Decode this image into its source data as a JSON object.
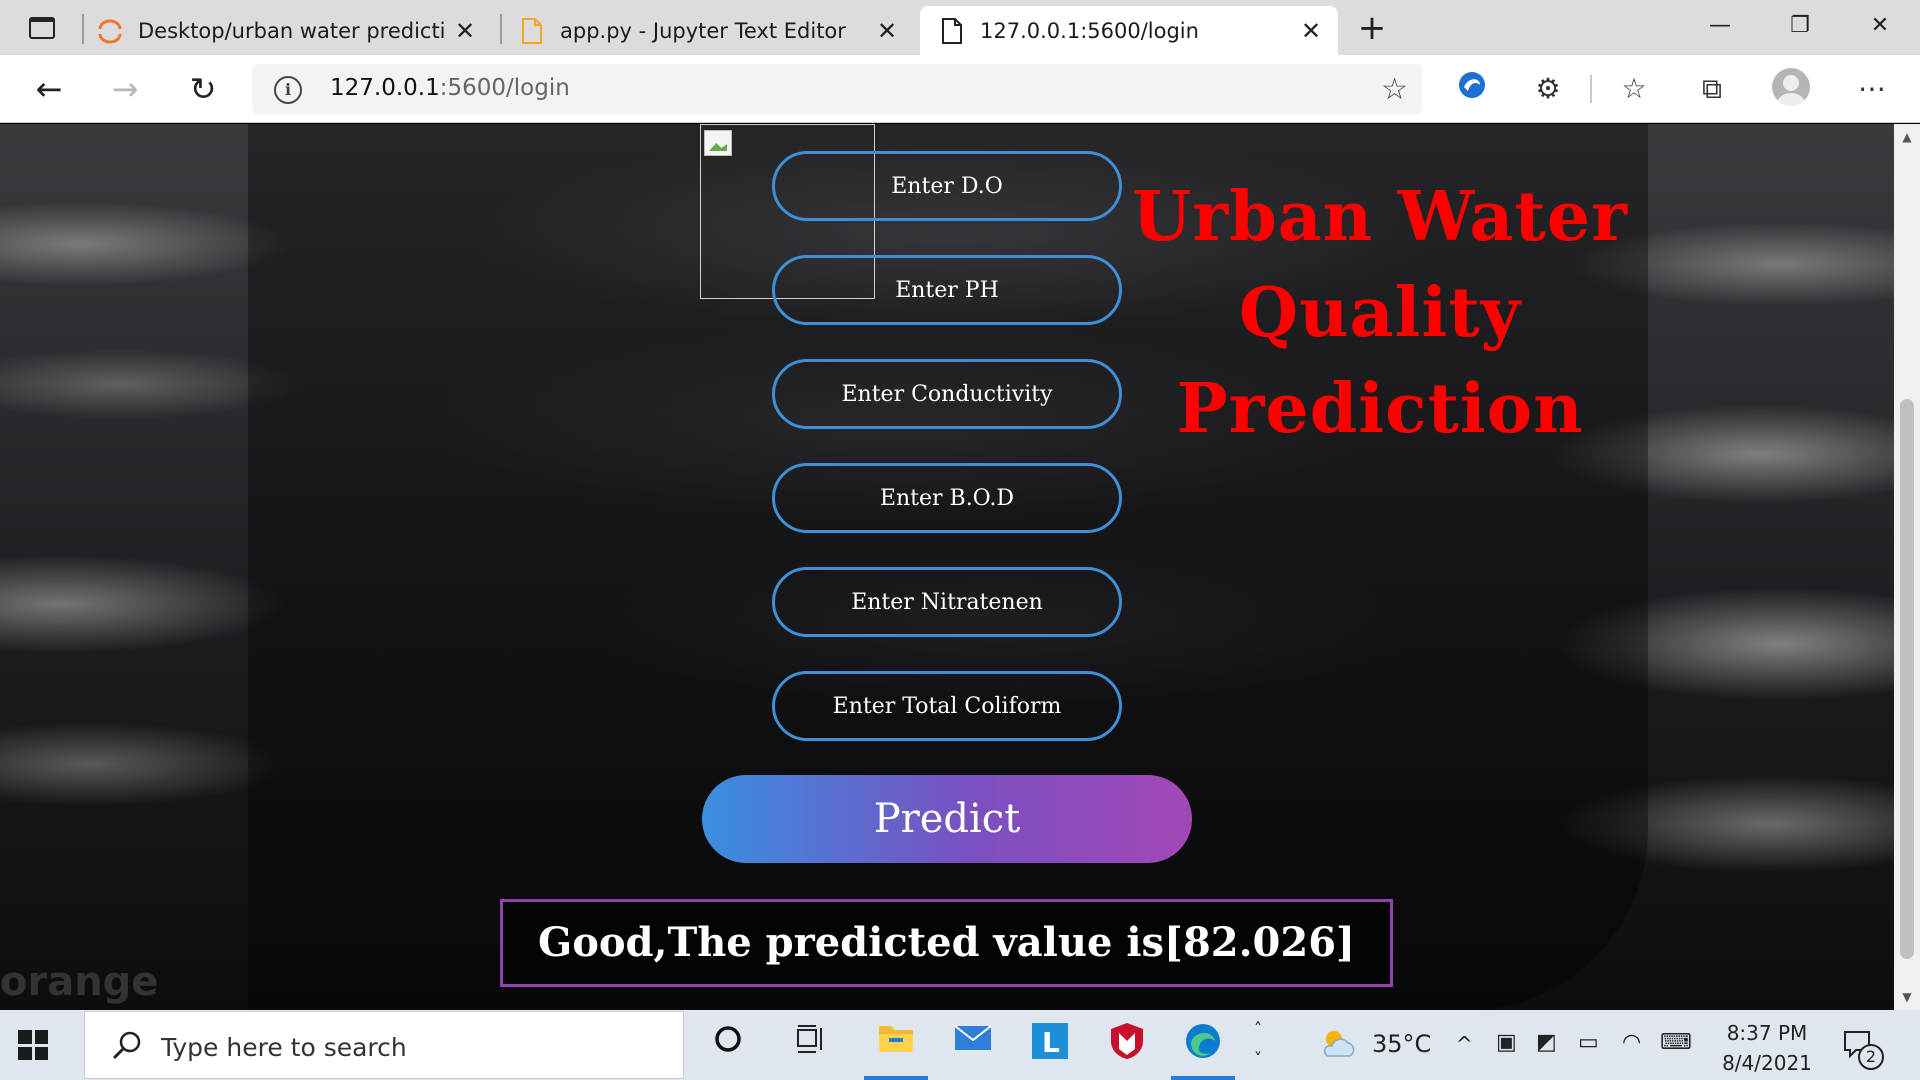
{
  "browser": {
    "tabs": [
      {
        "label": "Desktop/urban water prediction/",
        "icon": "jupyter-icon"
      },
      {
        "label": "app.py - Jupyter Text Editor",
        "icon": "file-icon"
      },
      {
        "label": "127.0.0.1:5600/login",
        "icon": "page-icon",
        "active": true
      }
    ],
    "address": {
      "host": "127.0.0.1",
      "path": ":5600/login"
    }
  },
  "page": {
    "title_line1": "Urban Water Quality",
    "title_line2": "Prediction",
    "fields": [
      {
        "placeholder": "Enter D.O"
      },
      {
        "placeholder": "Enter PH"
      },
      {
        "placeholder": "Enter Conductivity"
      },
      {
        "placeholder": "Enter B.O.D"
      },
      {
        "placeholder": "Enter Nitratenen"
      },
      {
        "placeholder": "Enter Total Coliform"
      }
    ],
    "predict_label": "Predict",
    "result_text": "Good,The predicted value is[82.026]",
    "watermark": "orange"
  },
  "taskbar": {
    "search_placeholder": "Type here to search",
    "weather": "35°C",
    "time": "8:37 PM",
    "date": "8/4/2021",
    "notification_count": "2"
  },
  "colors": {
    "title": "#ff0000",
    "field_border": "#3f8fd6",
    "result_border": "#8e44ad",
    "predict_gradient": [
      "#3a8fe0",
      "#a347b8"
    ]
  }
}
